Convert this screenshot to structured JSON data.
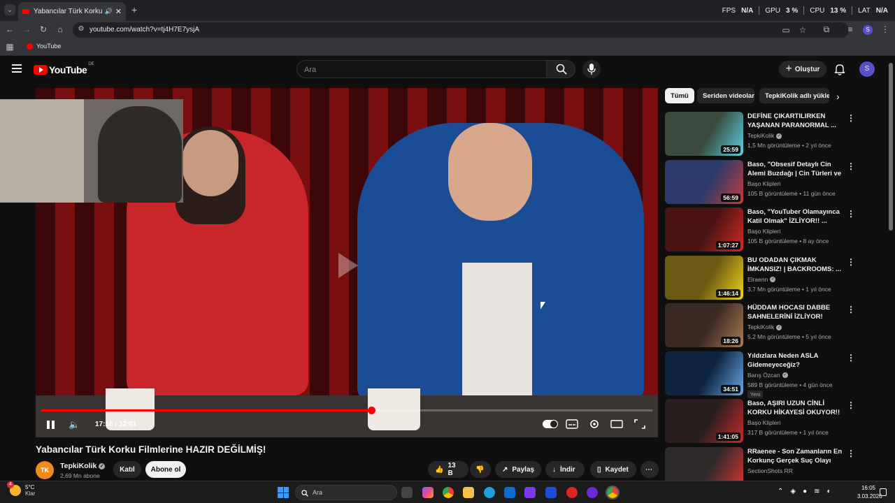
{
  "browser": {
    "tab_title": "Yabancılar Türk Korku Filmle...",
    "tab_audio_icon": "speaker-icon",
    "url": "youtube.com/watch?v=tj4H7E7ysjA",
    "bookmark_label": "YouTube"
  },
  "stats": {
    "fps_label": "FPS",
    "fps_value": "N/A",
    "gpu_label": "GPU",
    "gpu_value": "3 %",
    "cpu_label": "CPU",
    "cpu_value": "13 %",
    "lat_label": "LAT",
    "lat_value": "N/A"
  },
  "masthead": {
    "logo_text": "YouTube",
    "country_code": "DE",
    "search_placeholder": "Ara",
    "create_label": "Oluştur",
    "avatar_letter": "S"
  },
  "player": {
    "time": "17:18 / 32:01",
    "progress_fraction": 0.54,
    "channel_logo_text": "TK"
  },
  "video": {
    "title": "Yabancılar Türk Korku Filmlerine HAZIR DEĞİLMİŞ!",
    "channel": "TepkiKolik",
    "subscribers": "2,69 Mn abone",
    "join_label": "Katıl",
    "subscribe_label": "Abone ol",
    "likes": "13 B",
    "share_label": "Paylaş",
    "download_label": "İndir",
    "save_label": "Kaydet"
  },
  "chips": [
    "Tümü",
    "Seriden videolar",
    "TepkiKolik adlı yükley"
  ],
  "recommendations": [
    {
      "title": "DEFİNE ÇIKARTILIRKEN YAŞANAN PARANORMAL ...",
      "channel": "TepkiKolik",
      "verified": true,
      "meta": "1,5 Mn görüntüleme • 2 yıl önce",
      "duration": "25:59",
      "thumb_color": "#3a4a3e",
      "accent": "#5ad1e0"
    },
    {
      "title": "Baso, \"Obsesif Detaylı Cin Alemi Buzdağı | Cin Türleri ve ...",
      "channel": "Başo Klipleri",
      "verified": false,
      "meta": "105 B görüntüleme • 11 gün önce",
      "duration": "56:59",
      "thumb_color": "#2b3a6b",
      "accent": "#c23c3c"
    },
    {
      "title": "Baso, \"YouTuber Olamayınca Katil Olmak\" İZLİYOR!! ...",
      "channel": "Başo Klipleri",
      "verified": false,
      "meta": "105 B görüntüleme • 8 ay önce",
      "duration": "1:07:27",
      "thumb_color": "#4b1414",
      "accent": "#d62828"
    },
    {
      "title": "BU ODADAN ÇIKMAK İMKANSIZ! | BACKROOMS: ...",
      "channel": "Elraenn",
      "verified": true,
      "meta": "3,7 Mn görüntüleme • 1 yıl önce",
      "duration": "1:46:14",
      "thumb_color": "#6b5a14",
      "accent": "#f2d21b"
    },
    {
      "title": "HÜDDAM HOCASI DABBE SAHNELERİNİ İZLİYOR!",
      "channel": "TepkiKolik",
      "verified": true,
      "meta": "5,2 Mn görüntüleme • 5 yıl önce",
      "duration": "18:26",
      "thumb_color": "#3a2a22",
      "accent": "#a77a55"
    },
    {
      "title": "Yıldızlara Neden ASLA Gidemeyeceğiz?",
      "channel": "Barış Özcan",
      "verified": true,
      "meta": "589 B görüntüleme • 4 gün önce",
      "duration": "34:51",
      "thumb_color": "#0f2440",
      "accent": "#6aa7e6",
      "badge": "Yeni"
    },
    {
      "title": "Baso, AŞIRI UZUN CİNLİ KORKU HİKAYESİ OKUYOR!!",
      "channel": "Başo Klipleri",
      "verified": false,
      "meta": "317 B görüntüleme • 1 yıl önce",
      "duration": "1:41:05",
      "thumb_color": "#2a1e1e",
      "accent": "#c92a2a"
    },
    {
      "title": "RRaenee - Son Zamanların En Korkunç Gerçek Suç Olayı Tep...",
      "channel": "SectionShots RR",
      "verified": false,
      "meta": "",
      "duration": "",
      "thumb_color": "#2e2a2a",
      "accent": "#d33"
    }
  ],
  "taskbar": {
    "weather_temp": "5°C",
    "weather_desc": "Klar",
    "weather_badge": "4",
    "search_placeholder": "Ara",
    "time": "16:05",
    "date": "3.03.2026"
  },
  "colors": {
    "accent_red": "#ff0000",
    "page_bg": "#0f0f0f"
  }
}
